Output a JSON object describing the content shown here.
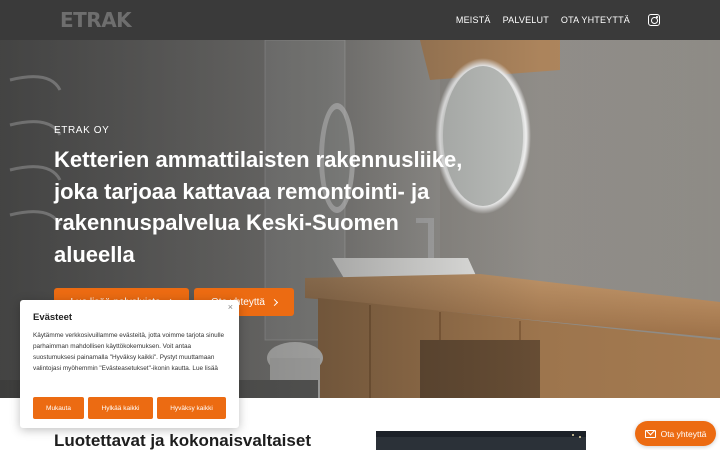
{
  "header": {
    "logo": "ETRAK",
    "nav": [
      "MEISTÄ",
      "PALVELUT",
      "OTA YHTEYTTÄ"
    ],
    "social_icon": "instagram-icon"
  },
  "hero": {
    "eyebrow": "ETRAK OY",
    "title": "Ketterien ammattilaisten rakennusliike, joka tarjoaa kattavaa remontointi- ja rakennuspalvelua Keski-Suomen alueella",
    "primary_button": "Lue lisää palveluista",
    "secondary_button": "Ota yhteyttä",
    "button_icon": "chevron-right-icon"
  },
  "section": {
    "title": "Luotettavat ja kokonaisvaltaiset"
  },
  "cookie": {
    "title": "Evästeet",
    "text": "Käytämme verkkosivuillamme evästeitä, jotta voimme tarjota sinulle parhaimman mahdollisen käyttökokemuksen. Voit antaa suostumuksesi painamalla \"Hyväksy kaikki\". Pystyt muuttamaan valintojasi myöhemmin \"Evästeasetukset\"-ikonin kautta. Lue lisää",
    "buttons": [
      "Mukauta",
      "Hylkää kaikki",
      "Hyväksy kaikki"
    ],
    "close_symbol": "×"
  },
  "float_contact": {
    "label": "Ota yhteyttä",
    "icon": "mail-icon"
  },
  "colors": {
    "header_bg": "#3a3a3a",
    "accent": "#ec6b12"
  }
}
